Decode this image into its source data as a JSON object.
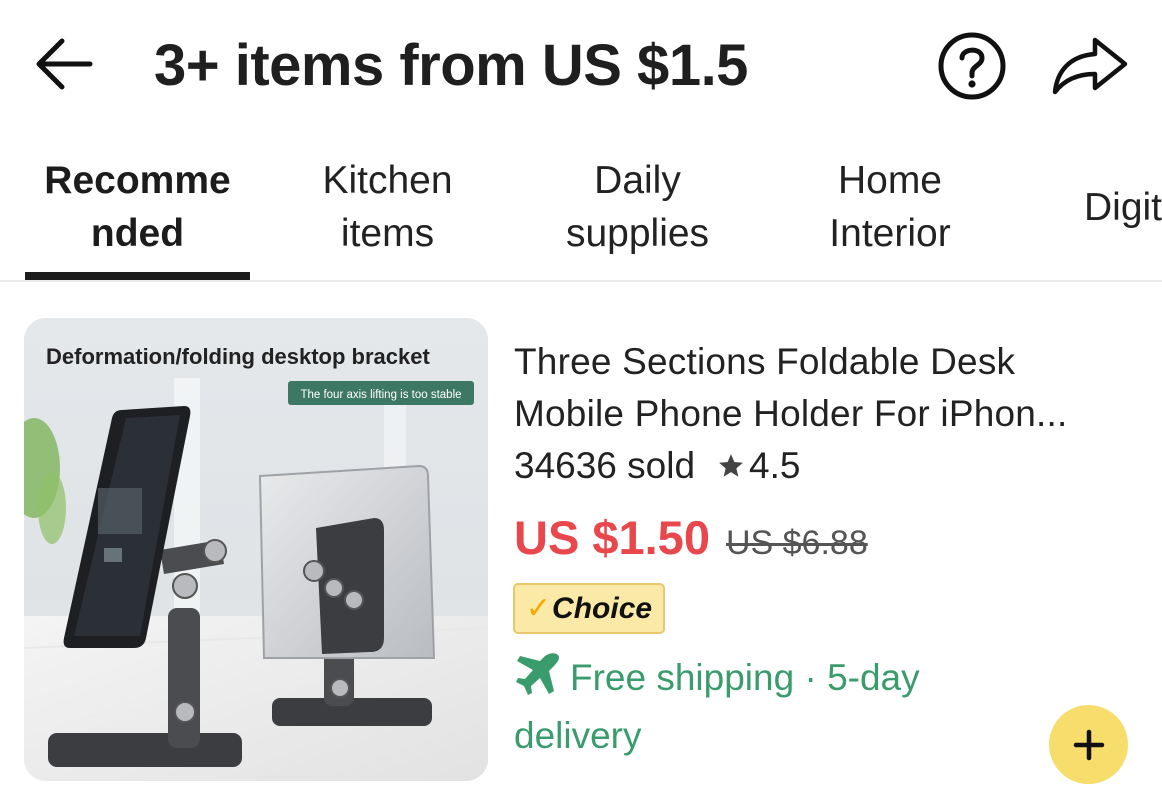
{
  "header": {
    "title": "3+ items from US $1.5"
  },
  "tabs": [
    {
      "line1": "Recomme",
      "line2": "nded",
      "active": true
    },
    {
      "line1": "Kitchen",
      "line2": "items",
      "active": false
    },
    {
      "line1": "Daily",
      "line2": "supplies",
      "active": false
    },
    {
      "line1": "Home",
      "line2": "Interior",
      "active": false
    },
    {
      "line1": "Digit",
      "line2": "",
      "active": false
    }
  ],
  "product": {
    "image": {
      "caption": "Deformation/folding desktop bracket",
      "tag": "The four axis lifting is too stable"
    },
    "title_line1": "Three Sections Foldable Desk",
    "title_line2": "Mobile Phone Holder For iPhon...",
    "sold": "34636 sold",
    "rating": "4.5",
    "price": "US $1.50",
    "original_price": "US $6.88",
    "badge": {
      "check": "✓",
      "label": "Choice"
    },
    "shipping": "Free shipping · 5-day delivery"
  },
  "icons": {
    "back": "arrow-left-icon",
    "help": "question-circle-icon",
    "share": "share-arrow-icon",
    "star": "star-icon",
    "plane": "airplane-icon",
    "add": "plus-icon"
  },
  "colors": {
    "price": "#e8474c",
    "shipping": "#3a9b6d",
    "choice_bg": "#fbe9a7",
    "add_button": "#f7dd6b"
  }
}
